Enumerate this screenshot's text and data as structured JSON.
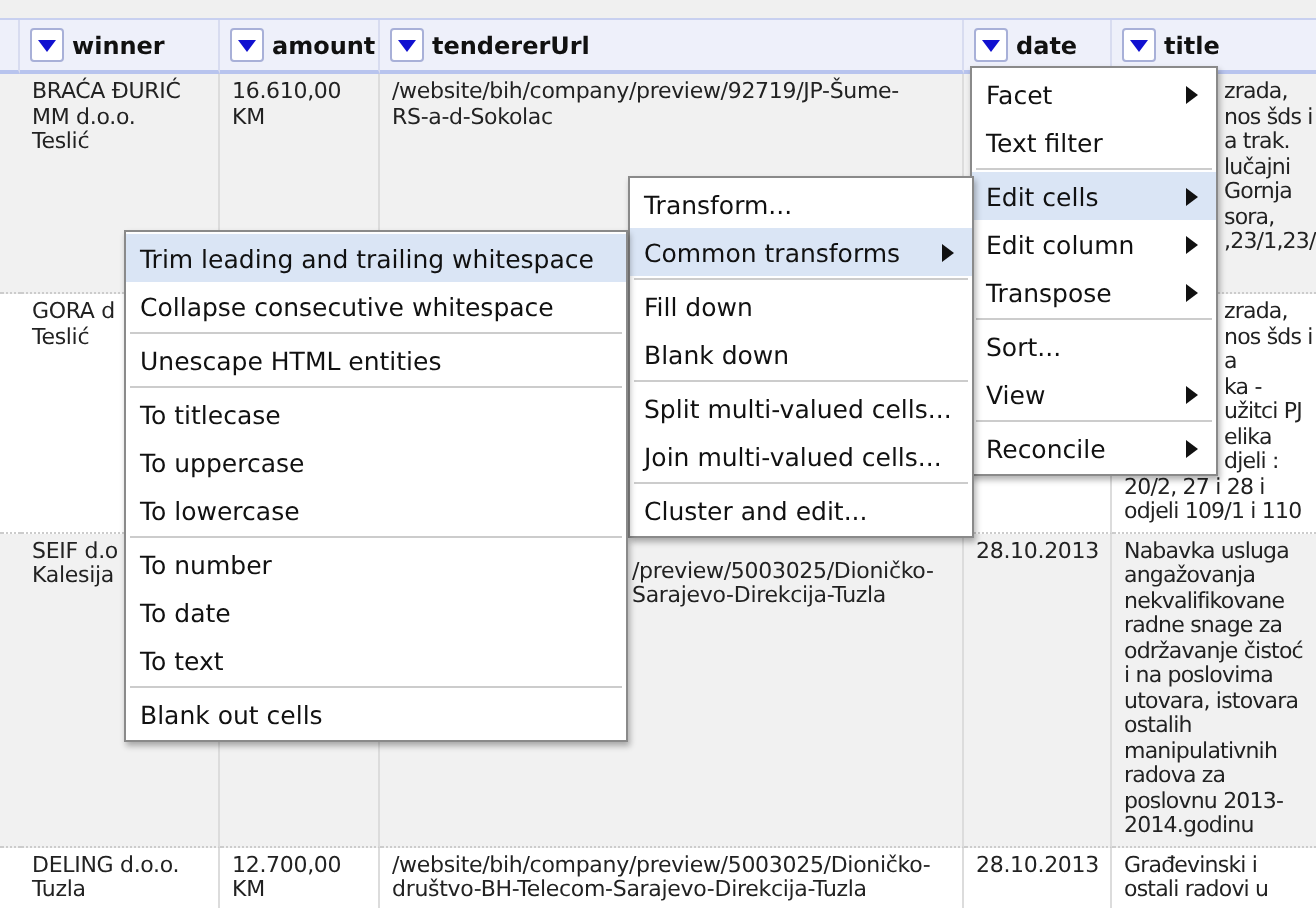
{
  "table": {
    "columns": [
      {
        "label": "winner"
      },
      {
        "label": "amount"
      },
      {
        "label": "tendererUrl"
      },
      {
        "label": "date"
      },
      {
        "label": "title"
      }
    ],
    "rows": [
      {
        "winner": [
          "BRAĆA ĐURIĆ",
          "MM d.o.o.",
          "Teslić"
        ],
        "amount": [
          "16.610,00",
          "KM"
        ],
        "tenderer_url": [
          "/website/bih/company/preview/92719/JP-Šume-",
          "RS-a-d-Sokolac"
        ],
        "title": [
          "zrada,",
          "nos šds i",
          "a trak.",
          "lučajni",
          "Gornja",
          "sora,",
          ",23/1,23/"
        ]
      },
      {
        "winner": [
          "GORA d",
          "Teslić"
        ],
        "title": [
          "zrada,",
          "nos šds i",
          "a",
          "ka -",
          "užitci PJ",
          "elika",
          "djeli :",
          "20/2, 27 i 28 i",
          "odjeli 109/1 i 110"
        ]
      },
      {
        "winner": [
          "SEIF d.o",
          "Kalesija"
        ],
        "tenderer_url": [
          "/preview/5003025/Dioničko-",
          "Sarajevo-Direkcija-Tuzla"
        ],
        "date": [
          "28.10.2013"
        ],
        "title": [
          "Nabavka usluga",
          "angažovanja",
          "nekvalifikovane",
          "radne snage za",
          "održavanje čistoć",
          "i na poslovima",
          "utovara, istovara",
          "ostalih",
          "manipulativnih",
          "radova za",
          "poslovnu 2013-",
          "2014.godinu"
        ]
      },
      {
        "winner": [
          "DELING d.o.o.",
          "Tuzla"
        ],
        "amount": [
          "12.700,00",
          "KM"
        ],
        "tenderer_url": [
          "/website/bih/company/preview/5003025/Dioničko-",
          "društvo-BH-Telecom-Sarajevo-Direkcija-Tuzla"
        ],
        "date": [
          "28.10.2013"
        ],
        "title": [
          "Građevinski i",
          "ostali radovi u"
        ]
      }
    ]
  },
  "menus": [
    {
      "items": [
        {
          "kind": "item",
          "label": "Facet",
          "submenu": true,
          "selected": false
        },
        {
          "kind": "item",
          "label": "Text filter",
          "submenu": false,
          "selected": false
        },
        {
          "kind": "separator"
        },
        {
          "kind": "item",
          "label": "Edit cells",
          "submenu": true,
          "selected": true
        },
        {
          "kind": "item",
          "label": "Edit column",
          "submenu": true,
          "selected": false
        },
        {
          "kind": "item",
          "label": "Transpose",
          "submenu": true,
          "selected": false
        },
        {
          "kind": "separator"
        },
        {
          "kind": "item",
          "label": "Sort...",
          "submenu": false,
          "selected": false
        },
        {
          "kind": "item",
          "label": "View",
          "submenu": true,
          "selected": false
        },
        {
          "kind": "separator"
        },
        {
          "kind": "item",
          "label": "Reconcile",
          "submenu": true,
          "selected": false
        }
      ]
    },
    {
      "items": [
        {
          "kind": "item",
          "label": "Transform...",
          "submenu": false,
          "selected": false
        },
        {
          "kind": "item",
          "label": "Common transforms",
          "submenu": true,
          "selected": true
        },
        {
          "kind": "separator"
        },
        {
          "kind": "item",
          "label": "Fill down",
          "submenu": false,
          "selected": false
        },
        {
          "kind": "item",
          "label": "Blank down",
          "submenu": false,
          "selected": false
        },
        {
          "kind": "separator"
        },
        {
          "kind": "item",
          "label": "Split multi-valued cells...",
          "submenu": false,
          "selected": false
        },
        {
          "kind": "item",
          "label": "Join multi-valued cells...",
          "submenu": false,
          "selected": false
        },
        {
          "kind": "separator"
        },
        {
          "kind": "item",
          "label": "Cluster and edit...",
          "submenu": false,
          "selected": false
        }
      ]
    },
    {
      "items": [
        {
          "kind": "item",
          "label": "Trim leading and trailing whitespace",
          "submenu": false,
          "selected": true
        },
        {
          "kind": "item",
          "label": "Collapse consecutive whitespace",
          "submenu": false,
          "selected": false
        },
        {
          "kind": "separator"
        },
        {
          "kind": "item",
          "label": "Unescape HTML entities",
          "submenu": false,
          "selected": false
        },
        {
          "kind": "separator"
        },
        {
          "kind": "item",
          "label": "To titlecase",
          "submenu": false,
          "selected": false
        },
        {
          "kind": "item",
          "label": "To uppercase",
          "submenu": false,
          "selected": false
        },
        {
          "kind": "item",
          "label": "To lowercase",
          "submenu": false,
          "selected": false
        },
        {
          "kind": "separator"
        },
        {
          "kind": "item",
          "label": "To number",
          "submenu": false,
          "selected": false
        },
        {
          "kind": "item",
          "label": "To date",
          "submenu": false,
          "selected": false
        },
        {
          "kind": "item",
          "label": "To text",
          "submenu": false,
          "selected": false
        },
        {
          "kind": "separator"
        },
        {
          "kind": "item",
          "label": "Blank out cells",
          "submenu": false,
          "selected": false
        }
      ]
    }
  ]
}
